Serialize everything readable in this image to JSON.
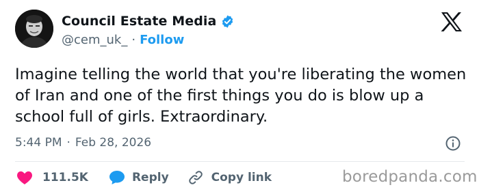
{
  "author": {
    "name": "Council Estate Media",
    "handle": "@cem_uk_",
    "separator": "·",
    "follow_label": "Follow",
    "verified": true
  },
  "tweet": {
    "text": "Imagine telling the world that you're liberating the women of Iran and one of the first things you do is blow up a school full of girls. Extraordinary.",
    "time": "5:44 PM",
    "separator": "·",
    "date": "Feb 28, 2026"
  },
  "actions": {
    "like_count": "111.5K",
    "reply_label": "Reply",
    "copy_link_label": "Copy link"
  },
  "watermark": "boredpanda.com",
  "icons": {
    "verified": "verified-badge-icon",
    "x_logo": "x-logo-icon",
    "info": "info-icon",
    "like": "heart-icon",
    "reply": "speech-bubble-icon",
    "copy": "link-icon"
  },
  "colors": {
    "accent": "#1d9bf0",
    "like": "#f91880",
    "text": "#0f1419",
    "muted": "#536471"
  }
}
